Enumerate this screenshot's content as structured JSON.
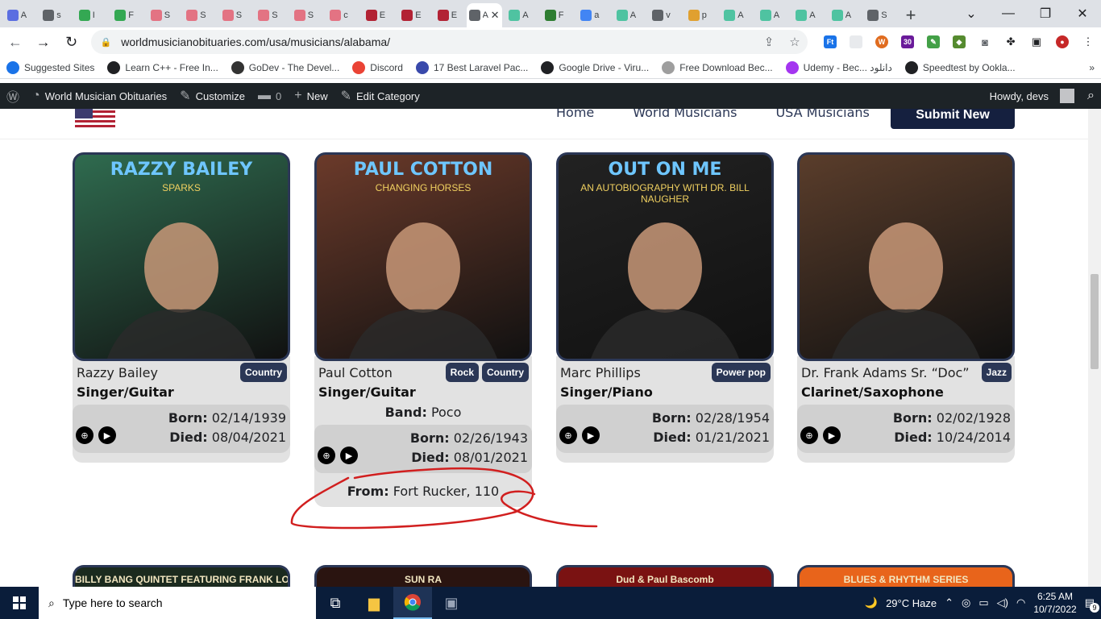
{
  "browser": {
    "tabs": [
      {
        "title": "A",
        "icon": "ws-icon",
        "color": "#5b6ee1"
      },
      {
        "title": "s",
        "icon": "globe-icon",
        "color": "#5f6368"
      },
      {
        "title": "I",
        "icon": "fi-icon",
        "color": "#34a853"
      },
      {
        "title": "F",
        "icon": "fi-icon",
        "color": "#34a853"
      },
      {
        "title": "S",
        "icon": "s-diamond-icon",
        "color": "#e37383"
      },
      {
        "title": "S",
        "icon": "s-diamond-icon",
        "color": "#e37383"
      },
      {
        "title": "S",
        "icon": "s-diamond-icon",
        "color": "#e37383"
      },
      {
        "title": "S",
        "icon": "s-diamond-icon",
        "color": "#e37383"
      },
      {
        "title": "S",
        "icon": "s-diamond-icon",
        "color": "#e37383"
      },
      {
        "title": "c",
        "icon": "s-diamond-icon",
        "color": "#e37383"
      },
      {
        "title": "E",
        "icon": "us-flag-icon",
        "color": "#b22234"
      },
      {
        "title": "E",
        "icon": "us-flag-icon",
        "color": "#b22234"
      },
      {
        "title": "E",
        "icon": "us-flag-icon",
        "color": "#b22234"
      },
      {
        "title": "A",
        "icon": "page-icon",
        "color": "#5f6368",
        "active": true
      },
      {
        "title": "A",
        "icon": "a-icon",
        "color": "#4fc3a1"
      },
      {
        "title": "F",
        "icon": "w-icon",
        "color": "#2e7d32"
      },
      {
        "title": "a",
        "icon": "google-icon",
        "color": "#4285f4"
      },
      {
        "title": "A",
        "icon": "a-icon",
        "color": "#4fc3a1"
      },
      {
        "title": "v",
        "icon": "globe-icon",
        "color": "#5f6368"
      },
      {
        "title": "p",
        "icon": "hand-icon",
        "color": "#e0a030"
      },
      {
        "title": "A",
        "icon": "a-icon",
        "color": "#4fc3a1"
      },
      {
        "title": "A",
        "icon": "a-icon",
        "color": "#4fc3a1"
      },
      {
        "title": "A",
        "icon": "a-icon",
        "color": "#4fc3a1"
      },
      {
        "title": "A",
        "icon": "a-icon",
        "color": "#4fc3a1"
      },
      {
        "title": "S",
        "icon": "wordpress-icon",
        "color": "#5f6368"
      }
    ],
    "url": "worldmusicianobituaries.com/usa/musicians/alabama/",
    "bookmarks": [
      {
        "label": "Suggested Sites",
        "color": "#1a73e8"
      },
      {
        "label": "Learn C++ - Free In...",
        "color": "#202124"
      },
      {
        "label": "GoDev - The Devel...",
        "color": "#333333"
      },
      {
        "label": "Discord",
        "color": "#ea4335"
      },
      {
        "label": "17 Best Laravel Pac...",
        "color": "#3949ab"
      },
      {
        "label": "Google Drive - Viru...",
        "color": "#202124"
      },
      {
        "label": "Free Download Bec...",
        "color": "#9e9e9e"
      },
      {
        "label": "Udemy - Bec... دانلود",
        "color": "#a435f0"
      },
      {
        "label": "Speedtest by Ookla...",
        "color": "#202124"
      }
    ]
  },
  "wpbar": {
    "site": "World Musician Obituaries",
    "customize": "Customize",
    "comments": "0",
    "new": "New",
    "edit": "Edit Category",
    "howdy": "Howdy, devs"
  },
  "site": {
    "nav": [
      "Home",
      "World Musicians",
      "USA Musicians"
    ],
    "submit": "Submit New"
  },
  "musicians": [
    {
      "name": "Razzy Bailey",
      "genres": [
        "Country"
      ],
      "role": "Singer/Guitar",
      "band_label": "",
      "band": "",
      "born_label": "Born:",
      "born": "02/14/1939",
      "died_label": "Died:",
      "died": "08/04/2021",
      "from_label": "",
      "from": "",
      "photo_text": "RAZZY BAILEY",
      "photo_sub": "SPARKS",
      "photo_bg": "#2f6b4f"
    },
    {
      "name": "Paul Cotton",
      "genres": [
        "Rock",
        "Country"
      ],
      "role": "Singer/Guitar",
      "band_label": "Band:",
      "band": "Poco",
      "born_label": "Born:",
      "born": "02/26/1943",
      "died_label": "Died:",
      "died": "08/01/2021",
      "from_label": "From:",
      "from": "Fort Rucker, 110",
      "photo_text": "PAUL COTTON",
      "photo_sub": "CHANGING HORSES",
      "photo_bg": "#6b3a2a"
    },
    {
      "name": "Marc Phillips",
      "genres": [
        "Power pop"
      ],
      "role": "Singer/Piano",
      "band_label": "",
      "band": "",
      "born_label": "Born:",
      "born": "02/28/1954",
      "died_label": "Died:",
      "died": "01/21/2021",
      "from_label": "",
      "from": "",
      "photo_text": "OUT ON ME",
      "photo_sub": "AN AUTOBIOGRAPHY WITH DR. BILL NAUGHER",
      "photo_bg": "#222222"
    },
    {
      "name": "Dr. Frank Adams Sr. “Doc”",
      "genres": [
        "Jazz"
      ],
      "role": "Clarinet/Saxophone",
      "band_label": "",
      "band": "",
      "born_label": "Born:",
      "born": "02/02/1928",
      "died_label": "Died:",
      "died": "10/24/2014",
      "from_label": "",
      "from": "",
      "photo_text": "",
      "photo_sub": "",
      "photo_bg": "#5a3d2b"
    }
  ],
  "bottom_cards": [
    {
      "caption": "BILLY BANG QUINTET FEATURING FRANK LOWE",
      "bg": "#1b2a1e"
    },
    {
      "caption": "SUN RA",
      "bg": "#2a1410"
    },
    {
      "caption": "Dud & Paul Bascomb",
      "bg": "#7a1212"
    },
    {
      "caption": "BLUES & RHYTHM SERIES",
      "bg": "#e8641b"
    }
  ],
  "taskbar": {
    "search_placeholder": "Type here to search",
    "weather": "29°C  Haze",
    "time": "6:25 AM",
    "date": "10/7/2022",
    "notifications": "9"
  }
}
